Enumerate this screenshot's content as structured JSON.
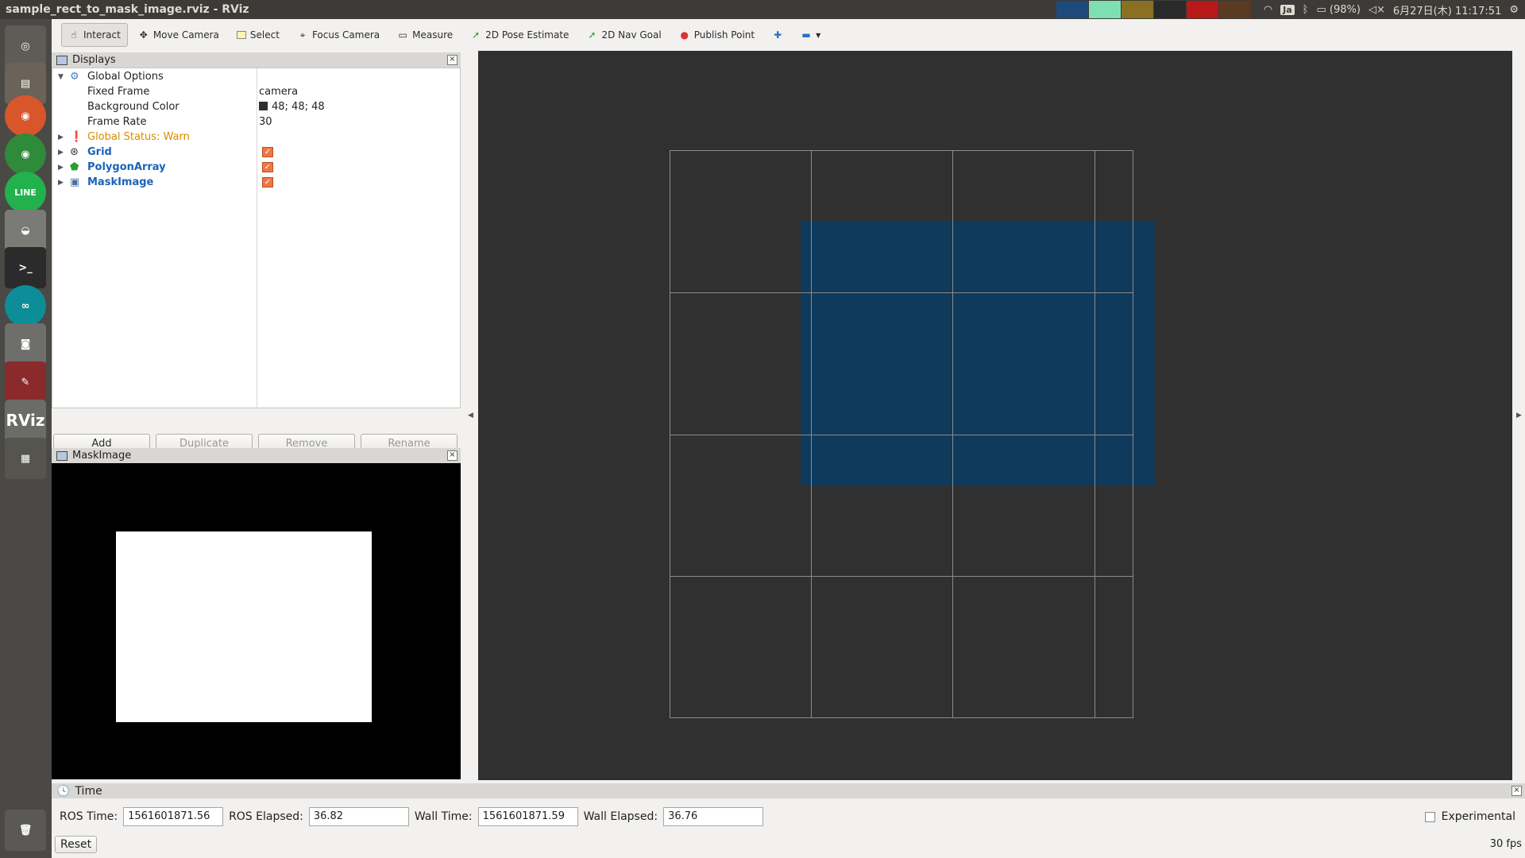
{
  "window": {
    "title": "sample_rect_to_mask_image.rviz - RViz"
  },
  "system": {
    "lang": "Ja",
    "battery": "(98%)",
    "datetime": "6月27日(木) 11:17:51"
  },
  "launcher": {
    "items": [
      "ubuntu-dash",
      "files",
      "firefox",
      "chrome",
      "line",
      "disk",
      "terminal",
      "arduino",
      "camera",
      "system-settings",
      "RViz",
      "workspaces",
      "trash"
    ],
    "rviz_label": "RViz"
  },
  "toolbar": {
    "tools": [
      {
        "label": "Interact",
        "icon": "hand-icon",
        "active": true
      },
      {
        "label": "Move Camera",
        "icon": "move-icon"
      },
      {
        "label": "Select",
        "icon": "select-icon"
      },
      {
        "label": "Focus Camera",
        "icon": "focus-icon"
      },
      {
        "label": "Measure",
        "icon": "ruler-icon"
      },
      {
        "label": "2D Pose Estimate",
        "icon": "green-arrow-icon"
      },
      {
        "label": "2D Nav Goal",
        "icon": "green-arrow-icon"
      },
      {
        "label": "Publish Point",
        "icon": "pin-icon"
      }
    ]
  },
  "displays": {
    "title": "Displays",
    "global_options": "Global Options",
    "fixed_frame": {
      "key": "Fixed Frame",
      "value": "camera"
    },
    "background_color": {
      "key": "Background Color",
      "value": "48; 48; 48",
      "color": "#303030"
    },
    "frame_rate": {
      "key": "Frame Rate",
      "value": "30"
    },
    "global_status": "Global Status: Warn",
    "items": [
      {
        "label": "Grid",
        "checked": true
      },
      {
        "label": "PolygonArray",
        "checked": true
      },
      {
        "label": "MaskImage",
        "checked": true
      }
    ],
    "buttons": {
      "add": "Add",
      "duplicate": "Duplicate",
      "remove": "Remove",
      "rename": "Rename"
    }
  },
  "mask_panel": {
    "title": "MaskImage"
  },
  "time": {
    "title": "Time",
    "ros_time_label": "ROS Time:",
    "ros_time": "1561601871.56",
    "ros_elapsed_label": "ROS Elapsed:",
    "ros_elapsed": "36.82",
    "wall_time_label": "Wall Time:",
    "wall_time": "1561601871.59",
    "wall_elapsed_label": "Wall Elapsed:",
    "wall_elapsed": "36.76",
    "experimental": "Experimental",
    "reset": "Reset",
    "fps": "30 fps"
  },
  "colors": {
    "viewport_bg": "#303030",
    "polygon_fill": "#0f3a5c",
    "grid_line": "#8a8a8a",
    "warn": "#d88b00",
    "display_name": "#1a64b8"
  }
}
